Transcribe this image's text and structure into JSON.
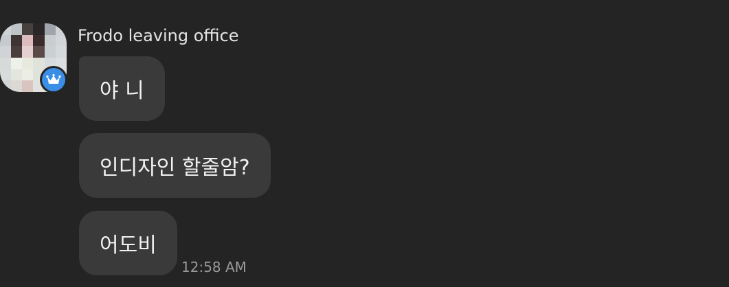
{
  "chat": {
    "sender_name": "Frodo leaving office",
    "avatar_icon": "blurred-profile-photo",
    "badge_icon": "crown-icon",
    "badge_color": "#3a8ee6",
    "messages": [
      {
        "text": "야 니"
      },
      {
        "text": "인디자인 할줄암?"
      },
      {
        "text": "어도비"
      }
    ],
    "timestamp": "12:58 AM"
  }
}
